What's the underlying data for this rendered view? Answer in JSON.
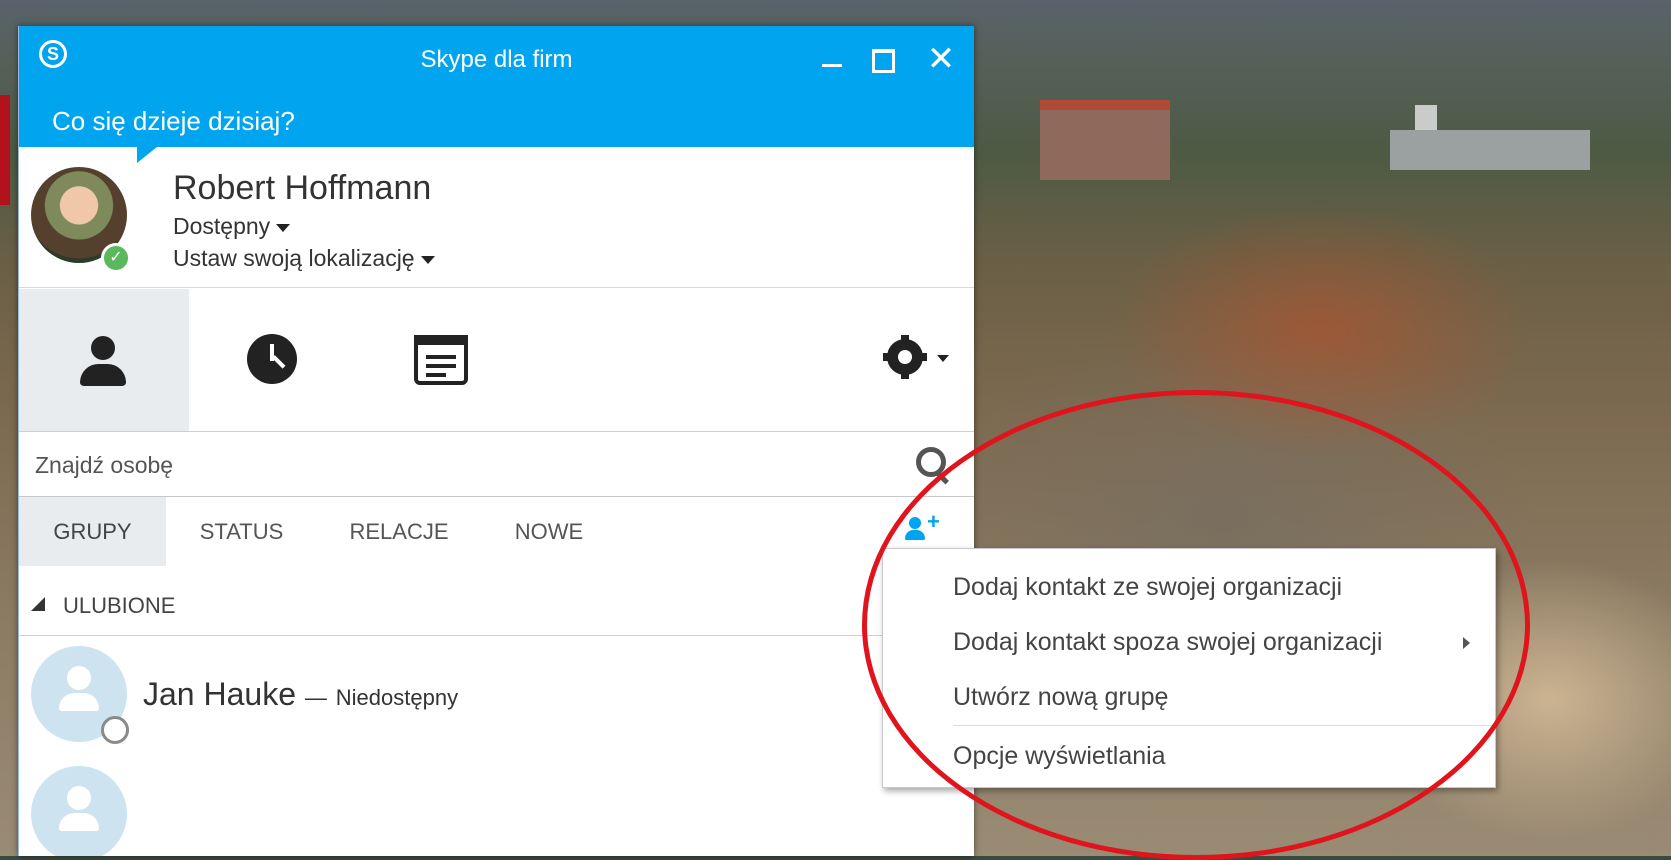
{
  "window": {
    "title": "Skype dla firm",
    "whats_happening": "Co się dzieje dzisiaj?"
  },
  "profile": {
    "name": "Robert Hoffmann",
    "status": "Dostępny",
    "location": "Ustaw swoją lokalizację",
    "presence_color": "#5cb85c"
  },
  "tabs": [
    {
      "icon": "person-icon",
      "active": true
    },
    {
      "icon": "clock-icon",
      "active": false
    },
    {
      "icon": "calendar-icon",
      "active": false
    }
  ],
  "search": {
    "placeholder": "Znajdź osobę"
  },
  "filters": [
    {
      "label": "GRUPY",
      "active": true
    },
    {
      "label": "STATUS",
      "active": false
    },
    {
      "label": "RELACJE",
      "active": false
    },
    {
      "label": "NOWE",
      "active": false
    }
  ],
  "groups": [
    {
      "label": "ULUBIONE",
      "contacts": [
        {
          "name": "Jan Hauke",
          "separator": "—",
          "status": "Niedostępny"
        }
      ]
    }
  ],
  "add_menu": {
    "items": [
      {
        "label": "Dodaj kontakt ze swojej organizacji",
        "has_submenu": false
      },
      {
        "label": "Dodaj kontakt spoza swojej organizacji",
        "has_submenu": true
      },
      {
        "label": "Utwórz nową grupę",
        "has_submenu": false
      },
      {
        "label": "Opcje wyświetlania",
        "has_submenu": false
      }
    ]
  },
  "colors": {
    "accent": "#00a4ef",
    "highlight": "#e0141d"
  }
}
